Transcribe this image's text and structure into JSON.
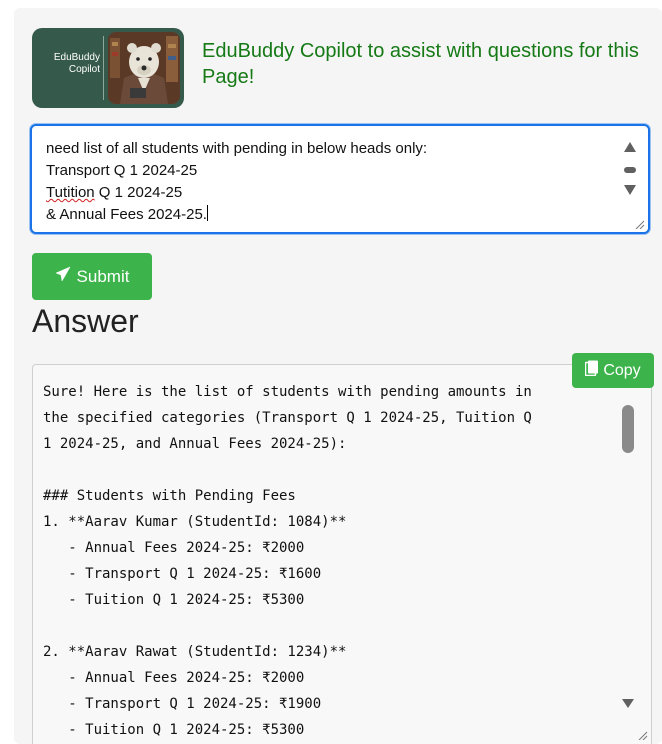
{
  "header": {
    "logo_line1": "EduBuddy",
    "logo_line2": "Copilot",
    "title": "EduBuddy Copilot to assist with questions for this Page!"
  },
  "question": {
    "line1": "need list of all students with pending in below heads only:",
    "line2": "Transport Q 1 2024-25",
    "line3_word": "Tutition",
    "line3_rest": " Q 1 2024-25",
    "line4": "& Annual Fees 2024-25."
  },
  "submit_label": "Submit",
  "answer_heading": "Answer",
  "copy_label": "Copy",
  "answer_lines": [
    "Sure! Here is the list of students with pending amounts in",
    "the specified categories (Transport Q 1 2024-25, Tuition Q",
    "1 2024-25, and Annual Fees 2024-25):",
    "",
    "### Students with Pending Fees",
    "1. **Aarav Kumar (StudentId: 1084)**",
    "   - Annual Fees 2024-25: ₹2000",
    "   - Transport Q 1 2024-25: ₹1600",
    "   - Tuition Q 1 2024-25: ₹5300",
    "",
    "2. **Aarav Rawat (StudentId: 1234)**",
    "   - Annual Fees 2024-25: ₹2000",
    "   - Transport Q 1 2024-25: ₹1900",
    "   - Tuition Q 1 2024-25: ₹5300"
  ],
  "colors": {
    "accent_green": "#3cb44b",
    "title_green": "#157a15",
    "focus_blue": "#1a73e8",
    "logo_bg": "#35594b"
  },
  "icons": {
    "submit": "paper-plane-icon",
    "copy": "clipboard-icon"
  }
}
